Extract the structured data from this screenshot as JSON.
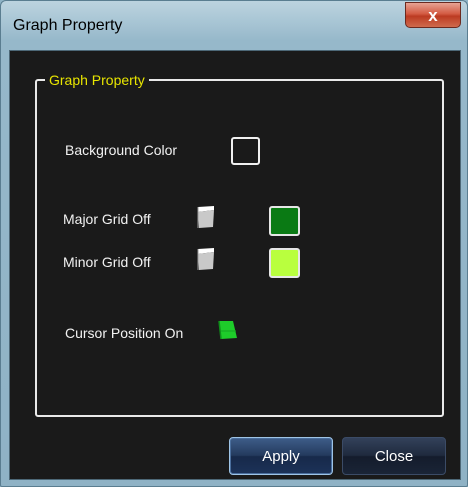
{
  "window": {
    "title": "Graph Property",
    "close_glyph": "x"
  },
  "group": {
    "legend": "Graph Property",
    "legend_color": "#e8e500"
  },
  "settings": {
    "background_color": {
      "label": "Background Color",
      "color": "#1a1a1a"
    },
    "major_grid": {
      "label": "Major Grid Off",
      "state": "off",
      "icon": "toggle-flag-icon",
      "color": "#0a7a14"
    },
    "minor_grid": {
      "label": "Minor Grid Off",
      "state": "off",
      "icon": "toggle-flag-icon",
      "color": "#b9ff3e"
    },
    "cursor_position": {
      "label": "Cursor Position On",
      "state": "on",
      "icon": "toggle-flag-icon",
      "color": "#1ecc2a"
    }
  },
  "buttons": {
    "apply": "Apply",
    "close": "Close"
  }
}
